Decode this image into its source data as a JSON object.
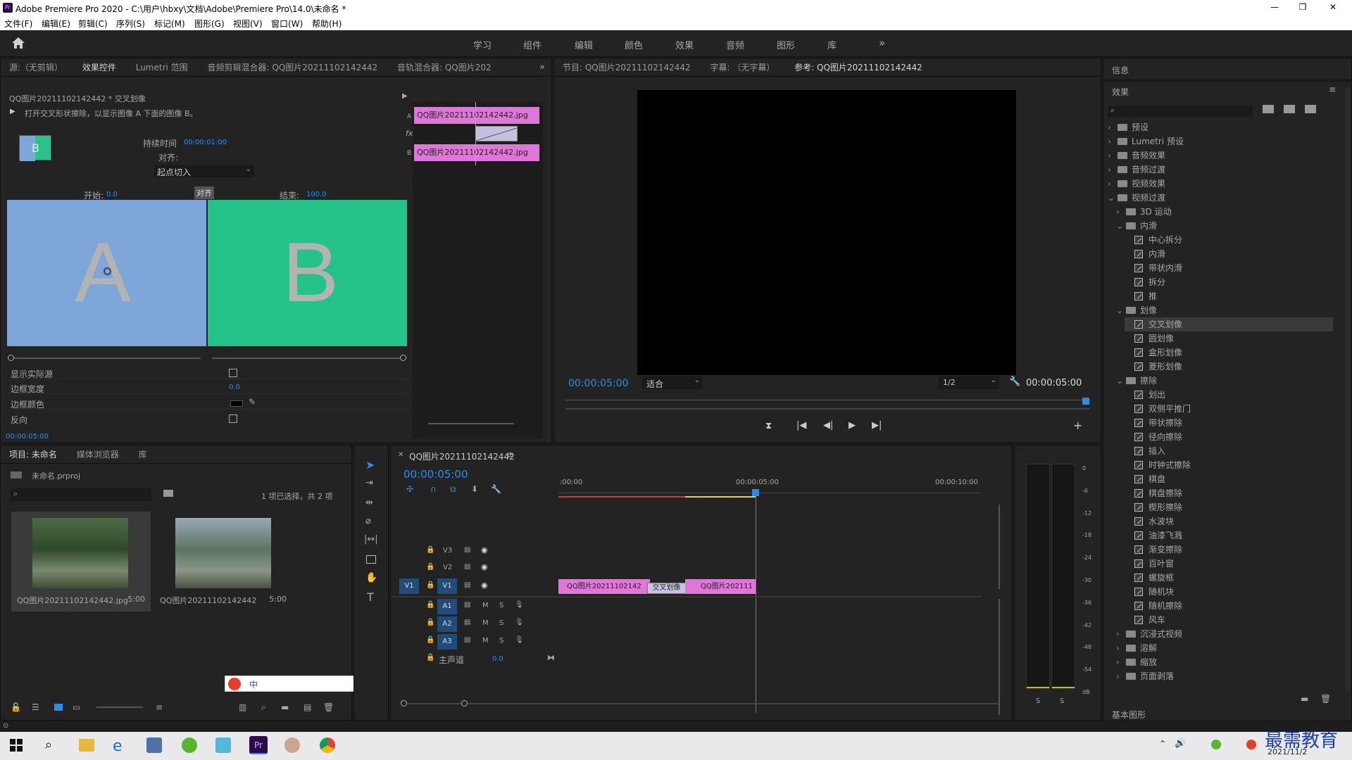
{
  "window": {
    "title": "Adobe Premiere Pro 2020 - C:\\用户\\hbxy\\文档\\Adobe\\Premiere Pro\\14.0\\未命名 *"
  },
  "menu": [
    "文件(F)",
    "编辑(E)",
    "剪辑(C)",
    "序列(S)",
    "标记(M)",
    "图形(G)",
    "视图(V)",
    "窗口(W)",
    "帮助(H)"
  ],
  "workspaces": [
    "学习",
    "组件",
    "编辑",
    "颜色",
    "效果",
    "音频",
    "图形",
    "库"
  ],
  "source_panel": {
    "tabs": [
      "源:（无剪辑）",
      "效果控件",
      "Lumetri 范围",
      "音频剪辑混合器: QQ图片20211102142442",
      "音轨混合器: QQ图片202"
    ],
    "clip_path": "QQ图片20211102142442 * 交叉划像",
    "description": "打开交叉形状擦除，以显示图像 A 下面的图像 B。",
    "duration_label": "持续时间",
    "duration": "00:00:01:00",
    "align_label": "对齐:",
    "align_value": "起点切入",
    "start_label": "开始:",
    "start_value": "0.0",
    "align_badge": "对齐",
    "end_label": "结束:",
    "end_value": "100.0",
    "thumb_b": "B",
    "preview_a": "A",
    "preview_b": "B",
    "show_actual_source": "显示实际源",
    "border_width_label": "边框宽度",
    "border_width": "0.0",
    "border_color_label": "边框颜色",
    "reverse_label": "反向",
    "time": "00:00:05:00",
    "mini_timeline": {
      "track_a": "A",
      "track_b": "B",
      "fx": "fx",
      "clip_a": "QQ图片20211102142442.jpg",
      "clip_b": "QQ图片20211102142442.jpg"
    }
  },
  "program_panel": {
    "tabs": [
      "节目: QQ图片20211102142442",
      "字幕: （无字幕）",
      "参考: QQ图片20211102142442"
    ],
    "timecode_left": "00:00:05:00",
    "fit": "适合",
    "quality": "1/2",
    "timecode_right": "00:00:05:00"
  },
  "info_panel": {
    "title": "信息"
  },
  "effects_panel": {
    "title": "效果",
    "search_placeholder": "",
    "tree": [
      {
        "label": "预设",
        "level": 0,
        "type": "folder",
        "twirl": "›"
      },
      {
        "label": "Lumetri 预设",
        "level": 0,
        "type": "folder",
        "twirl": "›"
      },
      {
        "label": "音频效果",
        "level": 0,
        "type": "folder",
        "twirl": "›"
      },
      {
        "label": "音频过渡",
        "level": 0,
        "type": "folder",
        "twirl": "›"
      },
      {
        "label": "视频效果",
        "level": 0,
        "type": "folder",
        "twirl": "›"
      },
      {
        "label": "视频过渡",
        "level": 0,
        "type": "folder",
        "twirl": "⌄"
      },
      {
        "label": "3D 运动",
        "level": 1,
        "type": "folder",
        "twirl": "›"
      },
      {
        "label": "内滑",
        "level": 1,
        "type": "folder",
        "twirl": "⌄"
      },
      {
        "label": "中心拆分",
        "level": 2,
        "type": "fx"
      },
      {
        "label": "内滑",
        "level": 2,
        "type": "fx"
      },
      {
        "label": "带状内滑",
        "level": 2,
        "type": "fx"
      },
      {
        "label": "拆分",
        "level": 2,
        "type": "fx"
      },
      {
        "label": "推",
        "level": 2,
        "type": "fx"
      },
      {
        "label": "划像",
        "level": 1,
        "type": "folder",
        "twirl": "⌄"
      },
      {
        "label": "交叉划像",
        "level": 2,
        "type": "fx",
        "selected": true
      },
      {
        "label": "圆划像",
        "level": 2,
        "type": "fx"
      },
      {
        "label": "盒形划像",
        "level": 2,
        "type": "fx"
      },
      {
        "label": "菱形划像",
        "level": 2,
        "type": "fx"
      },
      {
        "label": "擦除",
        "level": 1,
        "type": "folder",
        "twirl": "⌄"
      },
      {
        "label": "划出",
        "level": 2,
        "type": "fx"
      },
      {
        "label": "双侧平推门",
        "level": 2,
        "type": "fx"
      },
      {
        "label": "带状擦除",
        "level": 2,
        "type": "fx"
      },
      {
        "label": "径向擦除",
        "level": 2,
        "type": "fx"
      },
      {
        "label": "插入",
        "level": 2,
        "type": "fx"
      },
      {
        "label": "时钟式擦除",
        "level": 2,
        "type": "fx"
      },
      {
        "label": "棋盘",
        "level": 2,
        "type": "fx"
      },
      {
        "label": "棋盘擦除",
        "level": 2,
        "type": "fx"
      },
      {
        "label": "楔形擦除",
        "level": 2,
        "type": "fx"
      },
      {
        "label": "水波块",
        "level": 2,
        "type": "fx"
      },
      {
        "label": "油漆飞溅",
        "level": 2,
        "type": "fx"
      },
      {
        "label": "渐变擦除",
        "level": 2,
        "type": "fx"
      },
      {
        "label": "百叶窗",
        "level": 2,
        "type": "fx"
      },
      {
        "label": "螺旋框",
        "level": 2,
        "type": "fx"
      },
      {
        "label": "随机块",
        "level": 2,
        "type": "fx"
      },
      {
        "label": "随机擦除",
        "level": 2,
        "type": "fx"
      },
      {
        "label": "风车",
        "level": 2,
        "type": "fx"
      },
      {
        "label": "沉浸式视频",
        "level": 1,
        "type": "folder",
        "twirl": "›"
      },
      {
        "label": "溶解",
        "level": 1,
        "type": "folder",
        "twirl": "›"
      },
      {
        "label": "缩放",
        "level": 1,
        "type": "folder",
        "twirl": "›"
      },
      {
        "label": "页面剥落",
        "level": 1,
        "type": "folder",
        "twirl": "›"
      }
    ],
    "footer": "基本图形"
  },
  "project_panel": {
    "tabs": [
      "项目: 未命名",
      "媒体浏览器",
      "库"
    ],
    "project_file": "未命名.prproj",
    "selection_info": "1 项已选择，共 2 项",
    "items": [
      {
        "name": "QQ图片20211102142442.jpg",
        "duration": "5:00"
      },
      {
        "name": "QQ图片20211102142442",
        "duration": "5:00"
      }
    ]
  },
  "timeline": {
    "sequence": "QQ图片20211102142442",
    "timecode": "00:00:05:00",
    "ruler": [
      ":00:00",
      "00:00:05:00",
      "00:00:10:00"
    ],
    "tracks_video": [
      "V3",
      "V2",
      "V1"
    ],
    "tracks_audio": [
      "A1",
      "A2",
      "A3"
    ],
    "source_patch": "V1",
    "mute": "M",
    "solo": "S",
    "master_label": "主声道",
    "master_value": "0.0",
    "clip1": "QQ图片20211102142",
    "transition": "交叉划像",
    "clip2": "QQ图片202111"
  },
  "audio_meter": {
    "scale": [
      "0",
      "-6",
      "-12",
      "-18",
      "-24",
      "-30",
      "-36",
      "-42",
      "-48",
      "-54",
      "dB"
    ],
    "solo_left": "S",
    "solo_right": "S"
  },
  "taskbar": {
    "date": "2021/11/2",
    "watermark": "最需教育",
    "ime": "中"
  },
  "colors": {
    "accent": "#2d8ceb",
    "clip_pink": "#e077d8",
    "preview_a": "#7ea6d8",
    "preview_b": "#25c28a",
    "panel": "#232323"
  }
}
